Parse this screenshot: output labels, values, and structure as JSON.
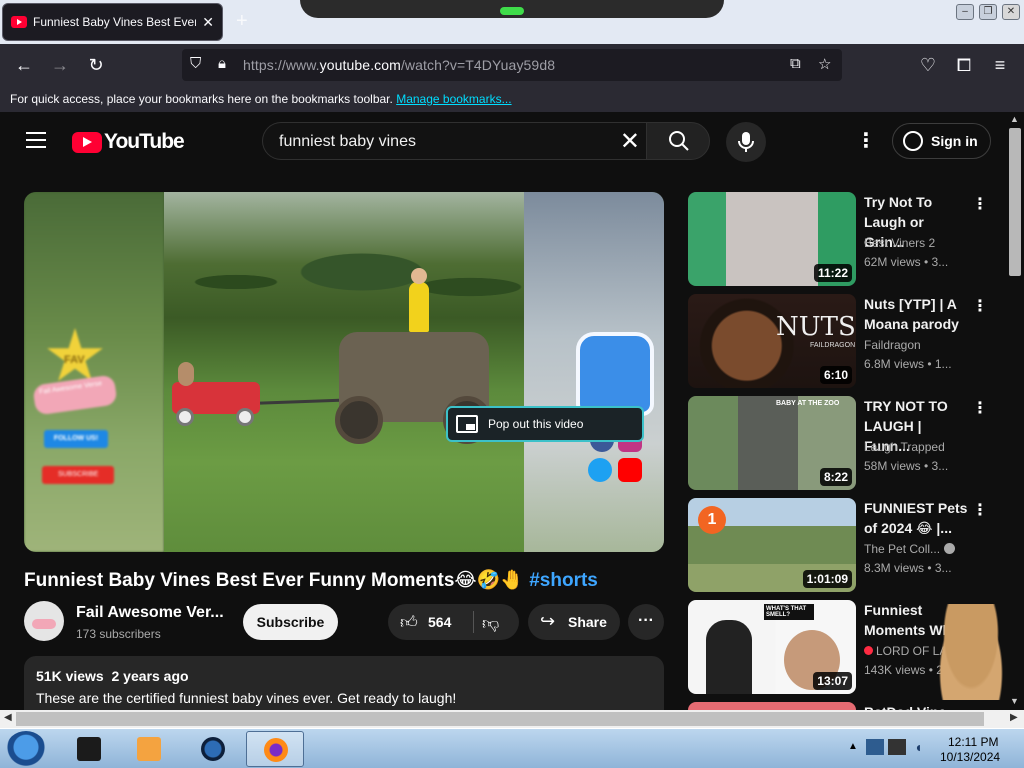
{
  "browser": {
    "tab_title": "Funniest Baby Vines Best Ever F",
    "new_tab": "+",
    "url_prefix": "https://www.",
    "url_domain": "youtube.com",
    "url_rest": "/watch?v=T4DYuay59d8",
    "bookmarks_message": "For quick access, place your bookmarks here on the bookmarks toolbar.",
    "bookmarks_link": "Manage bookmarks..."
  },
  "youtube": {
    "logo_text": "YouTube",
    "search_query": "funniest baby vines",
    "sign_in": "Sign in",
    "player": {
      "popout_label": "Pop out this video",
      "overlay_star": "FAV",
      "overlay_pill": "Fail Awesome Verse",
      "overlay_follow": "FOLLOW US!",
      "overlay_subscribe": "SUBSCRIBE"
    },
    "video": {
      "title": "Funniest Baby Vines Best Ever Funny Moments😂🤣🤚",
      "hashtag": "#shorts",
      "channel_name": "Fail Awesome Ver...",
      "channel_subs": "173 subscribers",
      "subscribe_label": "Subscribe",
      "like_count": "564",
      "share_label": "Share",
      "views": "51K views",
      "age": "2 years ago",
      "description": "These are the certified funniest baby vines ever. Get ready to laugh!"
    },
    "recommendations": [
      {
        "title": "Try Not To Laugh or Grin...",
        "channel": "Best Viners 2",
        "stats": "62M views  • 3...",
        "duration": "11:22"
      },
      {
        "title": "Nuts [YTP] | A Moana parody",
        "channel": "Faildragon",
        "stats": "6.8M views  • 1...",
        "duration": "6:10",
        "thumb_text": "NUTS",
        "thumb_sub": "FAILDRAGON"
      },
      {
        "title": "TRY NOT TO LAUGH | Funn...",
        "channel": "Laugh Trapped",
        "stats": "58M views  • 3...",
        "duration": "8:22",
        "thumb_text": "BABY AT THE ZOO"
      },
      {
        "title": "FUNNIEST Pets of 2024 😂 |...",
        "channel": "The Pet Coll...",
        "stats": "8.3M views  • 3...",
        "duration": "1:01:09",
        "thumb_badge": "1"
      },
      {
        "title": "Funniest Moments Wh...",
        "channel": "LORD OF LA...",
        "stats": "143K views  • 2...",
        "duration": "13:07",
        "thumb_text": "WHAT'S THAT SMELL?"
      },
      {
        "title": "BatDad Vine..."
      }
    ]
  },
  "taskbar": {
    "time": "12:11 PM",
    "date": "10/13/2024"
  }
}
